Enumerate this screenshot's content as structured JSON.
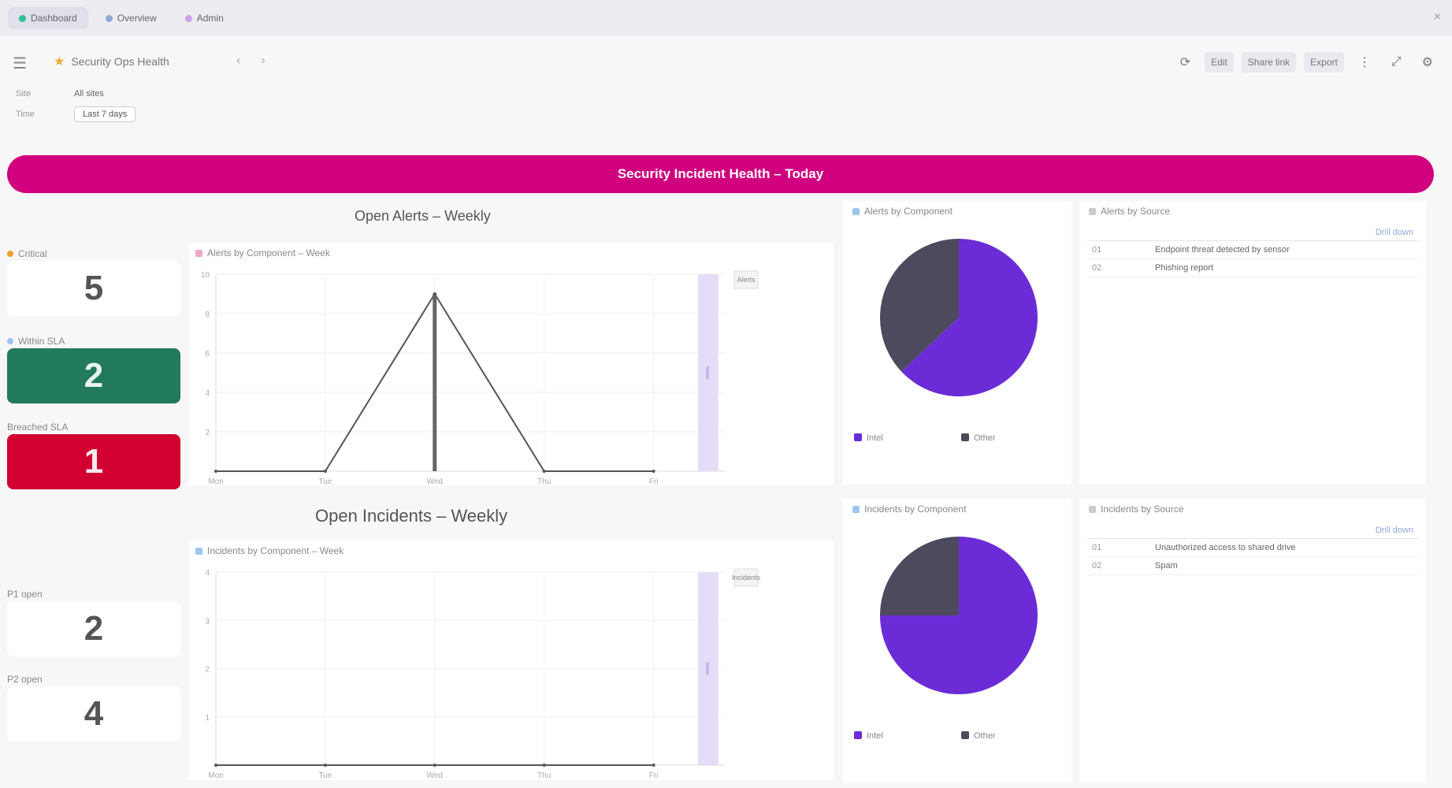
{
  "browser": {
    "tabs": [
      {
        "label": "Dashboard",
        "color": "#2fbf9a"
      },
      {
        "label": "Overview",
        "color": "#8fa8d8"
      },
      {
        "label": "Admin",
        "color": "#c9a3e8"
      }
    ],
    "close_glyph": "×"
  },
  "toolbar": {
    "menu_glyph": "☰",
    "title": "Security Ops Health",
    "back_glyph": "‹",
    "forward_glyph": "›",
    "filters": [
      {
        "label": "Site",
        "value": "All sites"
      },
      {
        "label": "Time",
        "value": "Last 7 days"
      }
    ],
    "buttons": [
      "⟳",
      "Edit",
      "Share link",
      "Export",
      "⋮",
      "⤢",
      "⚙"
    ]
  },
  "banner": {
    "text": "Security Incident Health – Today"
  },
  "sections": {
    "top_title": "Open Alerts – Weekly",
    "bottom_title": "Open Incidents – Weekly"
  },
  "stats": [
    {
      "label": "Critical",
      "value": "5",
      "style": "plain"
    },
    {
      "label": "Within SLA",
      "value": "2",
      "style": "green"
    },
    {
      "label": "Breached SLA",
      "value": "1",
      "style": "red"
    },
    {
      "label": "P1 open",
      "value": "2",
      "style": "plain"
    },
    {
      "label": "P2 open",
      "value": "4",
      "style": "plain"
    }
  ],
  "charts": {
    "top_line_title": "Alerts by Component – Week",
    "bottom_line_title": "Incidents by Component – Week",
    "top_pie_title": "Alerts by Component",
    "bottom_pie_title": "Incidents by Component",
    "top_pie_legend": [
      "Intel",
      "Other"
    ],
    "bottom_pie_legend": [
      "Intel",
      "Other"
    ]
  },
  "chart_data": [
    {
      "type": "line",
      "title": "Alerts by Component – Week",
      "x": [
        "Mon",
        "Tue",
        "Wed",
        "Thu",
        "Fri"
      ],
      "ylim": [
        0,
        10
      ],
      "yticks": [
        "10",
        "8",
        "6",
        "4",
        "2"
      ],
      "series": [
        {
          "name": "Alerts",
          "values": [
            0,
            0,
            9,
            0,
            0
          ]
        }
      ]
    },
    {
      "type": "line",
      "title": "Incidents by Component – Week",
      "x": [
        "Mon",
        "Tue",
        "Wed",
        "Thu",
        "Fri"
      ],
      "ylim": [
        0,
        4
      ],
      "yticks": [
        "4",
        "3",
        "2",
        "1"
      ],
      "series": [
        {
          "name": "Incidents",
          "values": [
            0,
            0,
            0,
            0,
            0
          ]
        }
      ]
    },
    {
      "type": "pie",
      "title": "Alerts by Component",
      "labels": [
        "Intel",
        "Other"
      ],
      "values": [
        63,
        37
      ],
      "colors": [
        "#6b2cd8",
        "#4d4a5e"
      ]
    },
    {
      "type": "pie",
      "title": "Incidents by Component",
      "labels": [
        "Intel",
        "Other"
      ],
      "values": [
        75,
        25
      ],
      "colors": [
        "#6b2cd8",
        "#4d4a5e"
      ]
    }
  ],
  "tables": {
    "top_title": "Alerts by Source",
    "bottom_title": "Incidents by Source",
    "top_action": "Drill down",
    "bottom_action": "Drill down",
    "top_rows": [
      {
        "id": "01",
        "name": "Endpoint threat detected by sensor"
      },
      {
        "id": "02",
        "name": "Phishing report"
      }
    ],
    "bottom_rows": [
      {
        "id": "01",
        "name": "Unauthorized access to shared drive"
      },
      {
        "id": "02",
        "name": "Spam"
      }
    ]
  },
  "colors": {
    "banner": "#d1007e",
    "pie_primary": "#6b2cd8",
    "pie_secondary": "#4d4a5e",
    "band": "#e6dcf8",
    "green": "#217a5a",
    "red": "#d10030"
  }
}
